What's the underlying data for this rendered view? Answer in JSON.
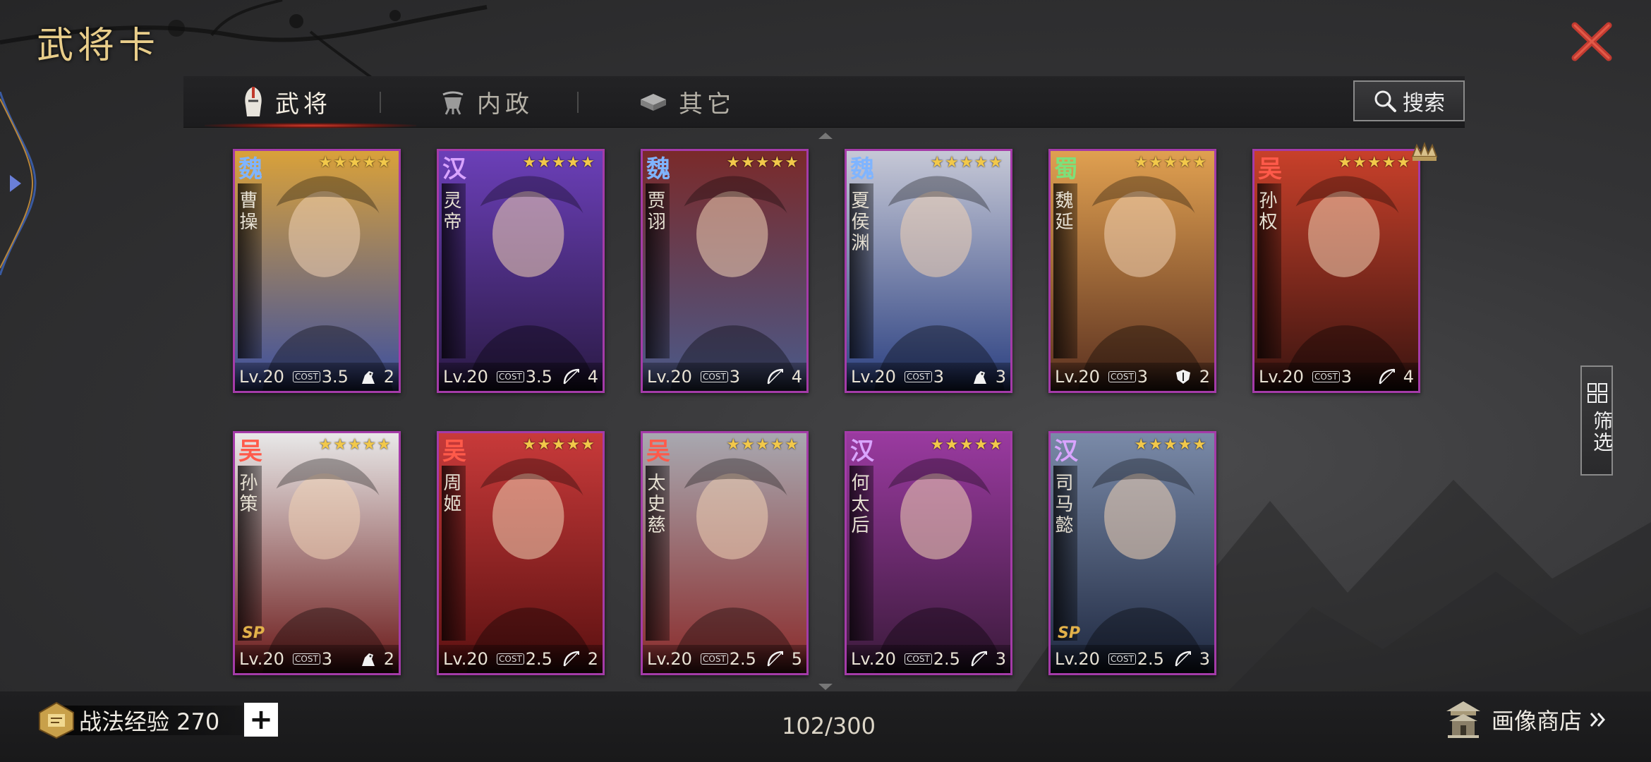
{
  "header": {
    "title": "武将卡"
  },
  "tabs": [
    {
      "label": "武将",
      "icon": "helmet-icon",
      "active": true
    },
    {
      "label": "内政",
      "icon": "cauldron-icon",
      "active": false
    },
    {
      "label": "其它",
      "icon": "ingot-icon",
      "active": false
    }
  ],
  "search": {
    "label": "搜索"
  },
  "filter": {
    "label": "筛选"
  },
  "cards": [
    {
      "faction": "魏",
      "faction_color": "#7fb4ff",
      "name": "曹操",
      "level": "Lv.20",
      "cost": "3.5",
      "troop_icon": "cavalry-icon",
      "troop_value": "2",
      "stars": "★★★★★",
      "sp": false
    },
    {
      "faction": "汉",
      "faction_color": "#d9a4ff",
      "name": "灵帝",
      "level": "Lv.20",
      "cost": "3.5",
      "troop_icon": "bow-icon",
      "troop_value": "4",
      "stars": "★★★★★",
      "sp": false
    },
    {
      "faction": "魏",
      "faction_color": "#7fb4ff",
      "name": "贾诩",
      "level": "Lv.20",
      "cost": "3",
      "troop_icon": "bow-icon",
      "troop_value": "4",
      "stars": "★★★★★",
      "sp": false
    },
    {
      "faction": "魏",
      "faction_color": "#7fb4ff",
      "name": "夏侯渊",
      "level": "Lv.20",
      "cost": "3",
      "troop_icon": "cavalry-icon",
      "troop_value": "3",
      "stars": "★★★★★",
      "sp": false
    },
    {
      "faction": "蜀",
      "faction_color": "#7ee07a",
      "name": "魏延",
      "level": "Lv.20",
      "cost": "3",
      "troop_icon": "shield-icon",
      "troop_value": "2",
      "stars": "★★★★★",
      "sp": false
    },
    {
      "faction": "吴",
      "faction_color": "#ff5a4a",
      "name": "孙权",
      "level": "Lv.20",
      "cost": "3",
      "troop_icon": "bow-icon",
      "troop_value": "4",
      "stars": "★★★★★",
      "sp": false
    },
    {
      "faction": "吴",
      "faction_color": "#ff5a4a",
      "name": "孙策",
      "level": "Lv.20",
      "cost": "3",
      "troop_icon": "cavalry-icon",
      "troop_value": "2",
      "stars": "★★★★★",
      "sp": true
    },
    {
      "faction": "吴",
      "faction_color": "#ff5a4a",
      "name": "周姬",
      "level": "Lv.20",
      "cost": "2.5",
      "troop_icon": "bow-icon",
      "troop_value": "2",
      "stars": "★★★★★",
      "sp": false
    },
    {
      "faction": "吴",
      "faction_color": "#ff5a4a",
      "name": "太史慈",
      "level": "Lv.20",
      "cost": "2.5",
      "troop_icon": "bow-icon",
      "troop_value": "5",
      "stars": "★★★★★",
      "sp": false
    },
    {
      "faction": "汉",
      "faction_color": "#d9a4ff",
      "name": "何太后",
      "level": "Lv.20",
      "cost": "2.5",
      "troop_icon": "bow-icon",
      "troop_value": "3",
      "stars": "★★★★★",
      "sp": false
    },
    {
      "faction": "汉",
      "faction_color": "#d9a4ff",
      "name": "司马懿",
      "level": "Lv.20",
      "cost": "2.5",
      "troop_icon": "bow-icon",
      "troop_value": "3",
      "stars": "★★★★★",
      "sp": true
    }
  ],
  "card_art_palettes": [
    [
      "#d9a13a",
      "#3b4fa0"
    ],
    [
      "#6b3fb8",
      "#2a1a44"
    ],
    [
      "#7a2a2a",
      "#4a5a8a"
    ],
    [
      "#c6c8d6",
      "#2a3f80"
    ],
    [
      "#e0a050",
      "#5a3020"
    ],
    [
      "#c8402a",
      "#3a1410"
    ],
    [
      "#e8e8e8",
      "#6a1818"
    ],
    [
      "#c83a3a",
      "#5a1010"
    ],
    [
      "#a8a8b0",
      "#8a2a2a"
    ],
    [
      "#9a3aa0",
      "#3a1a3a"
    ],
    [
      "#7a8aa8",
      "#1e2840"
    ]
  ],
  "cost_badge": "COST",
  "sp_label": "SP",
  "footer": {
    "exp_label": "战法经验 270",
    "plus_label": "+",
    "count": "102/300",
    "shop_label": "画像商店"
  }
}
